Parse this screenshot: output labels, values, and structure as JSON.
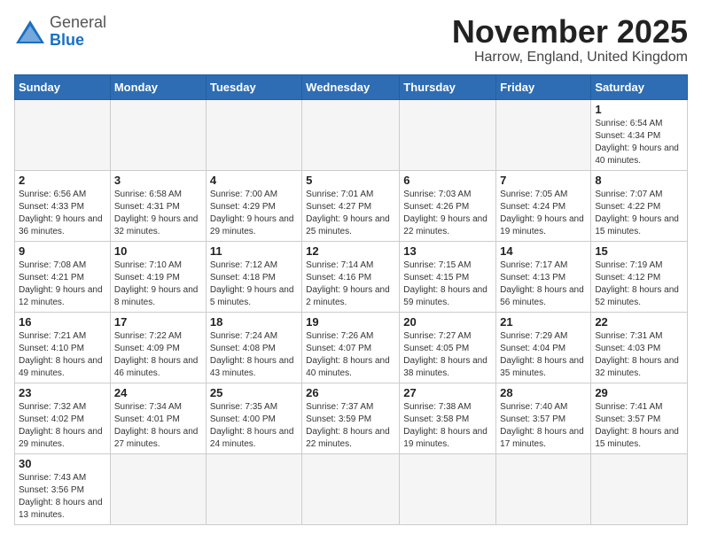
{
  "header": {
    "logo_line1": "General",
    "logo_line2": "Blue",
    "month": "November 2025",
    "location": "Harrow, England, United Kingdom"
  },
  "days_of_week": [
    "Sunday",
    "Monday",
    "Tuesday",
    "Wednesday",
    "Thursday",
    "Friday",
    "Saturday"
  ],
  "weeks": [
    [
      {
        "day": "",
        "info": ""
      },
      {
        "day": "",
        "info": ""
      },
      {
        "day": "",
        "info": ""
      },
      {
        "day": "",
        "info": ""
      },
      {
        "day": "",
        "info": ""
      },
      {
        "day": "",
        "info": ""
      },
      {
        "day": "1",
        "info": "Sunrise: 6:54 AM\nSunset: 4:34 PM\nDaylight: 9 hours and 40 minutes."
      }
    ],
    [
      {
        "day": "2",
        "info": "Sunrise: 6:56 AM\nSunset: 4:33 PM\nDaylight: 9 hours and 36 minutes."
      },
      {
        "day": "3",
        "info": "Sunrise: 6:58 AM\nSunset: 4:31 PM\nDaylight: 9 hours and 32 minutes."
      },
      {
        "day": "4",
        "info": "Sunrise: 7:00 AM\nSunset: 4:29 PM\nDaylight: 9 hours and 29 minutes."
      },
      {
        "day": "5",
        "info": "Sunrise: 7:01 AM\nSunset: 4:27 PM\nDaylight: 9 hours and 25 minutes."
      },
      {
        "day": "6",
        "info": "Sunrise: 7:03 AM\nSunset: 4:26 PM\nDaylight: 9 hours and 22 minutes."
      },
      {
        "day": "7",
        "info": "Sunrise: 7:05 AM\nSunset: 4:24 PM\nDaylight: 9 hours and 19 minutes."
      },
      {
        "day": "8",
        "info": "Sunrise: 7:07 AM\nSunset: 4:22 PM\nDaylight: 9 hours and 15 minutes."
      }
    ],
    [
      {
        "day": "9",
        "info": "Sunrise: 7:08 AM\nSunset: 4:21 PM\nDaylight: 9 hours and 12 minutes."
      },
      {
        "day": "10",
        "info": "Sunrise: 7:10 AM\nSunset: 4:19 PM\nDaylight: 9 hours and 8 minutes."
      },
      {
        "day": "11",
        "info": "Sunrise: 7:12 AM\nSunset: 4:18 PM\nDaylight: 9 hours and 5 minutes."
      },
      {
        "day": "12",
        "info": "Sunrise: 7:14 AM\nSunset: 4:16 PM\nDaylight: 9 hours and 2 minutes."
      },
      {
        "day": "13",
        "info": "Sunrise: 7:15 AM\nSunset: 4:15 PM\nDaylight: 8 hours and 59 minutes."
      },
      {
        "day": "14",
        "info": "Sunrise: 7:17 AM\nSunset: 4:13 PM\nDaylight: 8 hours and 56 minutes."
      },
      {
        "day": "15",
        "info": "Sunrise: 7:19 AM\nSunset: 4:12 PM\nDaylight: 8 hours and 52 minutes."
      }
    ],
    [
      {
        "day": "16",
        "info": "Sunrise: 7:21 AM\nSunset: 4:10 PM\nDaylight: 8 hours and 49 minutes."
      },
      {
        "day": "17",
        "info": "Sunrise: 7:22 AM\nSunset: 4:09 PM\nDaylight: 8 hours and 46 minutes."
      },
      {
        "day": "18",
        "info": "Sunrise: 7:24 AM\nSunset: 4:08 PM\nDaylight: 8 hours and 43 minutes."
      },
      {
        "day": "19",
        "info": "Sunrise: 7:26 AM\nSunset: 4:07 PM\nDaylight: 8 hours and 40 minutes."
      },
      {
        "day": "20",
        "info": "Sunrise: 7:27 AM\nSunset: 4:05 PM\nDaylight: 8 hours and 38 minutes."
      },
      {
        "day": "21",
        "info": "Sunrise: 7:29 AM\nSunset: 4:04 PM\nDaylight: 8 hours and 35 minutes."
      },
      {
        "day": "22",
        "info": "Sunrise: 7:31 AM\nSunset: 4:03 PM\nDaylight: 8 hours and 32 minutes."
      }
    ],
    [
      {
        "day": "23",
        "info": "Sunrise: 7:32 AM\nSunset: 4:02 PM\nDaylight: 8 hours and 29 minutes."
      },
      {
        "day": "24",
        "info": "Sunrise: 7:34 AM\nSunset: 4:01 PM\nDaylight: 8 hours and 27 minutes."
      },
      {
        "day": "25",
        "info": "Sunrise: 7:35 AM\nSunset: 4:00 PM\nDaylight: 8 hours and 24 minutes."
      },
      {
        "day": "26",
        "info": "Sunrise: 7:37 AM\nSunset: 3:59 PM\nDaylight: 8 hours and 22 minutes."
      },
      {
        "day": "27",
        "info": "Sunrise: 7:38 AM\nSunset: 3:58 PM\nDaylight: 8 hours and 19 minutes."
      },
      {
        "day": "28",
        "info": "Sunrise: 7:40 AM\nSunset: 3:57 PM\nDaylight: 8 hours and 17 minutes."
      },
      {
        "day": "29",
        "info": "Sunrise: 7:41 AM\nSunset: 3:57 PM\nDaylight: 8 hours and 15 minutes."
      }
    ],
    [
      {
        "day": "30",
        "info": "Sunrise: 7:43 AM\nSunset: 3:56 PM\nDaylight: 8 hours and 13 minutes."
      },
      {
        "day": "",
        "info": ""
      },
      {
        "day": "",
        "info": ""
      },
      {
        "day": "",
        "info": ""
      },
      {
        "day": "",
        "info": ""
      },
      {
        "day": "",
        "info": ""
      },
      {
        "day": "",
        "info": ""
      }
    ]
  ]
}
